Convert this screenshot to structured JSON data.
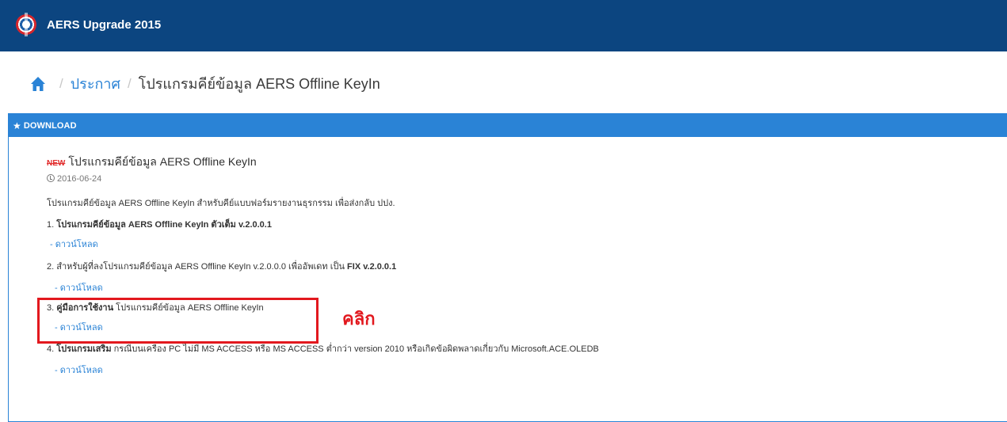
{
  "header": {
    "app_title": "AERS Upgrade 2015"
  },
  "breadcrumb": {
    "sep1": "/",
    "link": "ประกาศ",
    "sep2": "/",
    "current": "โปรแกรมคีย์ข้อมูล AERS Offline KeyIn"
  },
  "panel": {
    "heading": "DOWNLOAD",
    "new_badge": "NEW",
    "item_title": "โปรแกรมคีย์ข้อมูล AERS Offline KeyIn",
    "date": "2016-06-24",
    "description": "โปรแกรมคีย์ข้อมูล AERS Offline KeyIn สำหรับคีย์แบบฟอร์มรายงานธุรกรรม เพื่อส่งกลับ ปปง.",
    "items": [
      {
        "prefix": "1. ",
        "bold": "โปรแกรมคีย์ข้อมูล AERS Offline KeyIn ตัวเต็ม v.2.0.0.1",
        "rest": "",
        "download": "- ดาวน์โหลด"
      },
      {
        "prefix": "2. ",
        "bold": "",
        "rest": "สำหรับผู้ที่ลงโปรแกรมคีย์ข้อมูล AERS Offline KeyIn v.2.0.0.0 เพื่ออัพเดท เป็น ",
        "bold2": "FIX v.2.0.0.1",
        "download": "- ดาวน์โหลด"
      },
      {
        "prefix": "3. ",
        "bold": "คู่มือการใช้งาน",
        "rest": " โปรแกรมคีย์ข้อมูล AERS Offline KeyIn",
        "download": "- ดาวน์โหลด"
      },
      {
        "prefix": "4. ",
        "bold": "โปรแกรมเสริม",
        "rest": " กรณีบนเครื่อง PC ไม่มี MS ACCESS หรือ MS ACCESS ต่ำกว่า version 2010 หรือเกิดข้อผิดพลาดเกี่ยวกับ Microsoft.ACE.OLEDB",
        "download": "- ดาวน์โหลด"
      }
    ]
  },
  "annotation": {
    "click_label": "คลิก"
  },
  "colors": {
    "topbar": "#0c4580",
    "accent": "#2a83d6",
    "highlight": "#e2181e"
  }
}
